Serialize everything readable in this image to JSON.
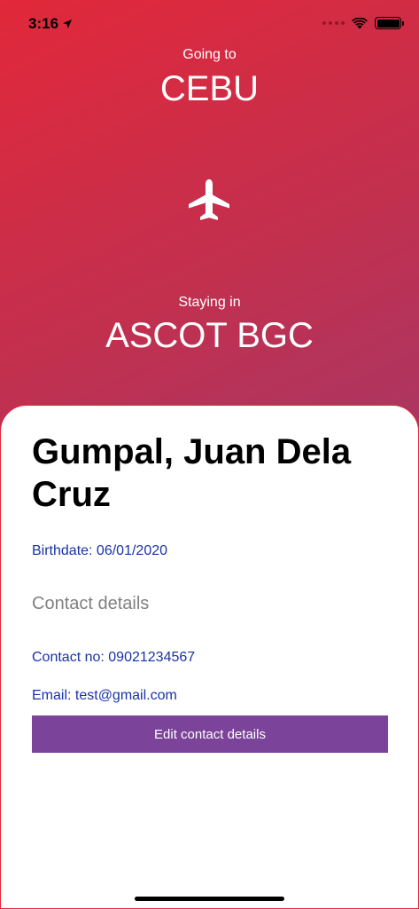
{
  "status_bar": {
    "time": "3:16",
    "location_icon": "location-arrow-icon",
    "signal_icon": "cellular-dots-icon",
    "wifi_icon": "wifi-icon",
    "battery_icon": "battery-icon"
  },
  "trip": {
    "going_label": "Going to",
    "going_value": "CEBU",
    "plane_icon": "airplane-icon",
    "staying_label": "Staying in",
    "staying_value": "ASCOT BGC"
  },
  "guest": {
    "name": "Gumpal, Juan Dela Cruz",
    "birthdate": "Birthdate: 06/01/2020",
    "contact_heading": "Contact details",
    "contact_no": "Contact no: 09021234567",
    "email": "Email: test@gmail.com",
    "edit_button_label": "Edit contact details"
  },
  "colors": {
    "gradient_start": "#e2283a",
    "gradient_end": "#7e4595",
    "accent_blue": "#1a32a8",
    "button_purple": "#7b4399",
    "card_border": "#e2283a"
  }
}
